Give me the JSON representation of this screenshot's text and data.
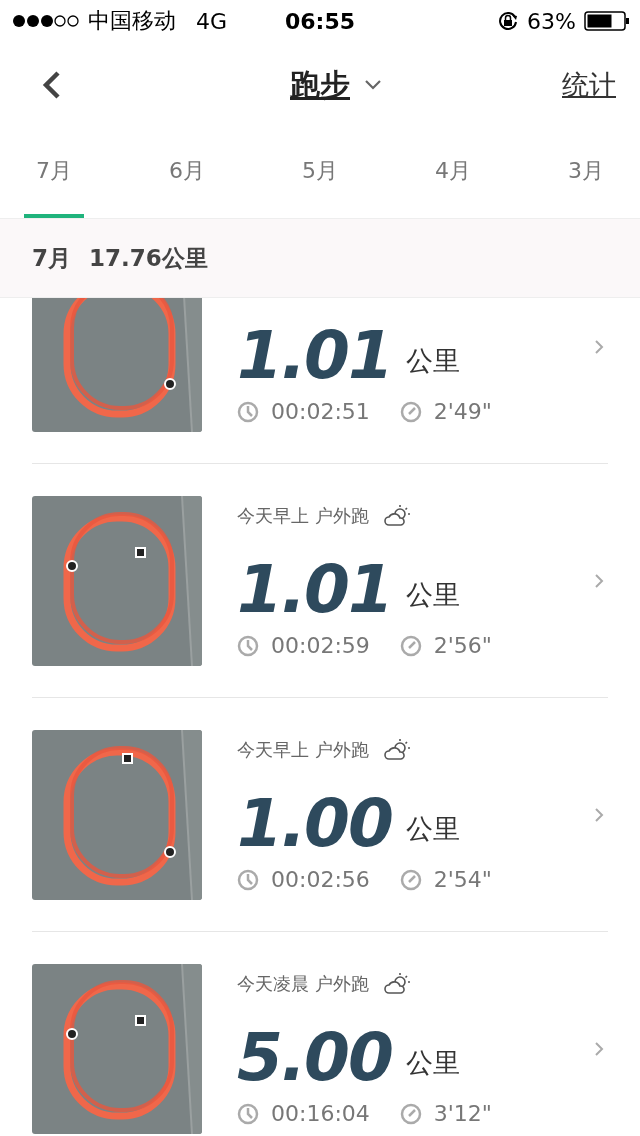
{
  "status_bar": {
    "carrier": "中国移动",
    "network": "4G",
    "time": "06:55",
    "battery": "63%"
  },
  "nav": {
    "title": "跑步",
    "action": "统计"
  },
  "tabs": [
    {
      "label": "7月",
      "selected": true
    },
    {
      "label": "6月",
      "selected": false
    },
    {
      "label": "5月",
      "selected": false
    },
    {
      "label": "4月",
      "selected": false
    },
    {
      "label": "3月",
      "selected": false
    }
  ],
  "summary": {
    "month": "7月",
    "total": "17.76公里"
  },
  "runs": [
    {
      "distance": "1.01",
      "unit": "公里",
      "duration": "00:02:51",
      "pace": "2'49\""
    },
    {
      "subtitle": "今天早上 户外跑",
      "distance": "1.01",
      "unit": "公里",
      "duration": "00:02:59",
      "pace": "2'56\""
    },
    {
      "subtitle": "今天早上 户外跑",
      "distance": "1.00",
      "unit": "公里",
      "duration": "00:02:56",
      "pace": "2'54\""
    },
    {
      "subtitle": "今天凌晨 户外跑",
      "distance": "5.00",
      "unit": "公里",
      "duration": "00:16:04",
      "pace": "3'12\""
    }
  ]
}
